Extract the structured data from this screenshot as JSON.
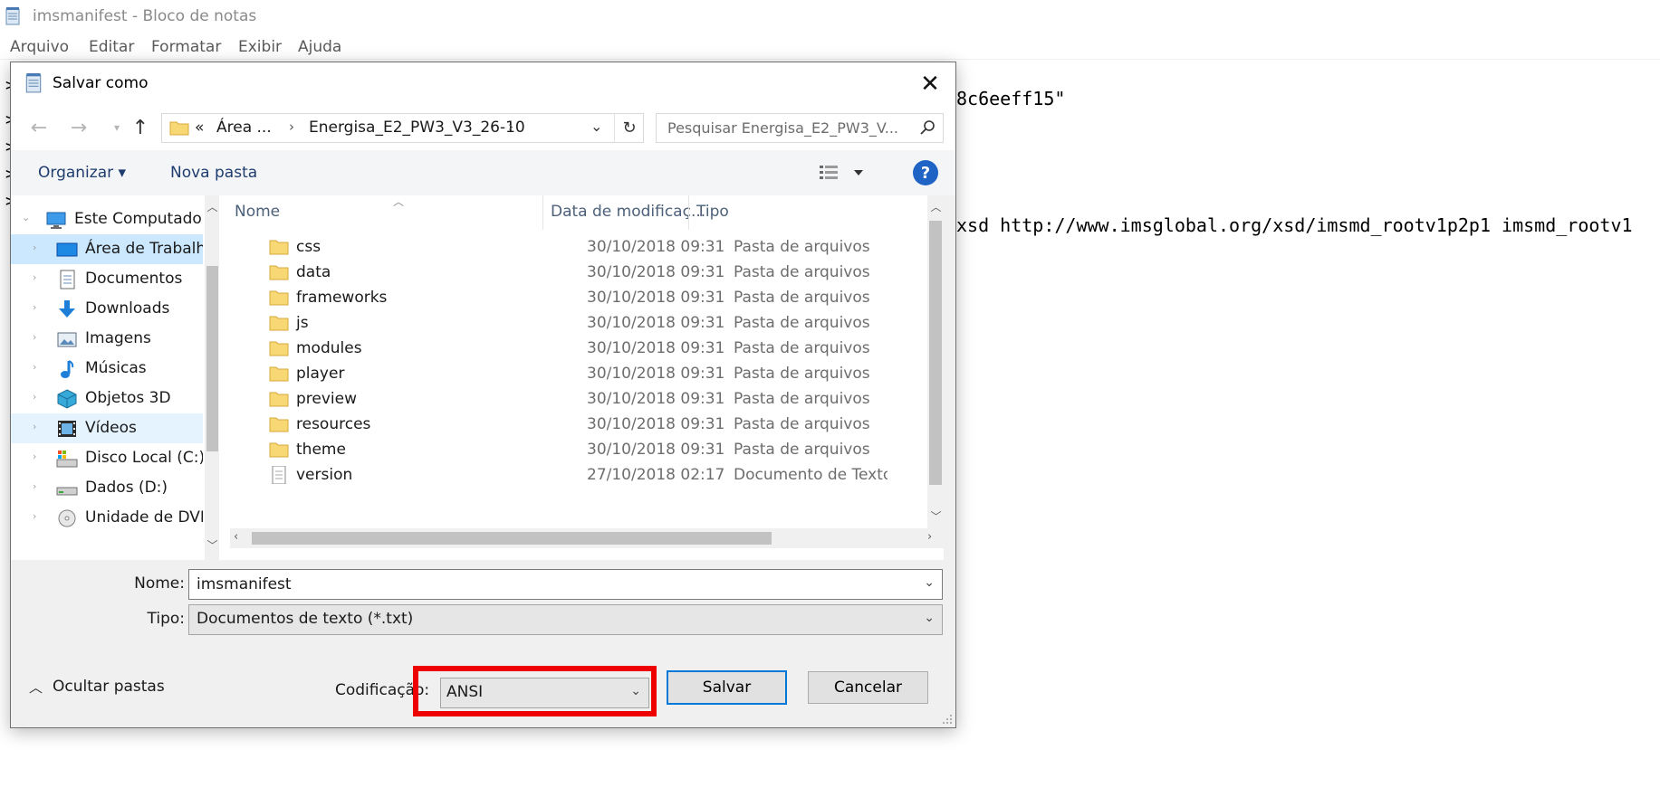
{
  "notepad": {
    "title": "imsmanifest - Bloco de notas",
    "menu": [
      "Arquivo",
      "Editar",
      "Formatar",
      "Exibir",
      "Ajuda"
    ],
    "visible_lines": [
      "8c6eeff15\"",
      "xsd http://www.imsglobal.org/xsd/imsmd_rootv1p2p1 imsmd_rootv1"
    ]
  },
  "dialog": {
    "title": "Salvar como",
    "close_glyph": "✕",
    "address": {
      "overflow": "«",
      "segments": [
        "Área ...",
        "Energisa_E2_PW3_V3_26-10"
      ]
    },
    "search_placeholder": "Pesquisar Energisa_E2_PW3_V...",
    "toolbar": {
      "organize": "Organizar ▾",
      "new_folder": "Nova pasta",
      "help": "?"
    },
    "tree": [
      {
        "label": "Este Computador",
        "icon": "computer-icon"
      },
      {
        "label": "Área de Trabalho",
        "icon": "desktop-icon"
      },
      {
        "label": "Documentos",
        "icon": "documents-icon"
      },
      {
        "label": "Downloads",
        "icon": "downloads-icon"
      },
      {
        "label": "Imagens",
        "icon": "pictures-icon"
      },
      {
        "label": "Músicas",
        "icon": "music-icon"
      },
      {
        "label": "Objetos 3D",
        "icon": "objects-3d-icon"
      },
      {
        "label": "Vídeos",
        "icon": "videos-icon"
      },
      {
        "label": "Disco Local (C:)",
        "icon": "drive-c-icon"
      },
      {
        "label": "Dados (D:)",
        "icon": "drive-d-icon"
      },
      {
        "label": "Unidade de DVD",
        "icon": "dvd-drive-icon"
      }
    ],
    "columns": {
      "name": "Nome",
      "date": "Data de modificaç...",
      "type": "Tipo"
    },
    "files": [
      {
        "name": "css",
        "date": "30/10/2018 09:31",
        "type": "Pasta de arquivos",
        "kind": "folder"
      },
      {
        "name": "data",
        "date": "30/10/2018 09:31",
        "type": "Pasta de arquivos",
        "kind": "folder"
      },
      {
        "name": "frameworks",
        "date": "30/10/2018 09:31",
        "type": "Pasta de arquivos",
        "kind": "folder"
      },
      {
        "name": "js",
        "date": "30/10/2018 09:31",
        "type": "Pasta de arquivos",
        "kind": "folder"
      },
      {
        "name": "modules",
        "date": "30/10/2018 09:31",
        "type": "Pasta de arquivos",
        "kind": "folder"
      },
      {
        "name": "player",
        "date": "30/10/2018 09:31",
        "type": "Pasta de arquivos",
        "kind": "folder"
      },
      {
        "name": "preview",
        "date": "30/10/2018 09:31",
        "type": "Pasta de arquivos",
        "kind": "folder"
      },
      {
        "name": "resources",
        "date": "30/10/2018 09:31",
        "type": "Pasta de arquivos",
        "kind": "folder"
      },
      {
        "name": "theme",
        "date": "30/10/2018 09:31",
        "type": "Pasta de arquivos",
        "kind": "folder"
      },
      {
        "name": "version",
        "date": "27/10/2018 02:17",
        "type": "Documento de Texto",
        "kind": "text-file"
      }
    ],
    "form": {
      "name_label": "Nome:",
      "name_value": "imsmanifest",
      "type_label": "Tipo:",
      "type_value": "Documentos de texto (*.txt)",
      "encoding_label": "Codificação:",
      "encoding_value": "ANSI",
      "hide_folders": "Ocultar pastas",
      "save": "Salvar",
      "cancel": "Cancelar"
    },
    "colors": {
      "highlight": "#ee0000",
      "accent": "#0078d7",
      "help": "#1f64c4",
      "link": "#1e3d6e"
    }
  }
}
